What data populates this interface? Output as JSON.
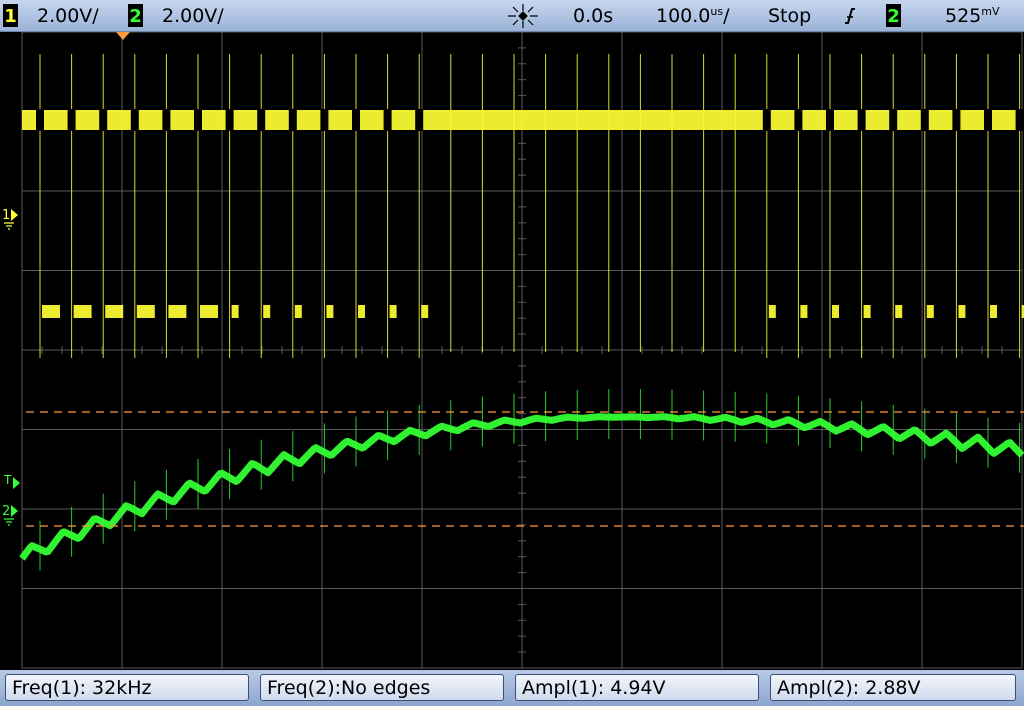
{
  "status_bar": {
    "ch1_label": "1",
    "ch1_scale": "2.00V/",
    "ch2_label": "2",
    "ch2_scale": "2.00V/",
    "acq_icon": "acquisition-icon",
    "time_offset": "0.0s",
    "timebase_value": "100.0",
    "timebase_unit": "us",
    "timebase_suffix": "/",
    "run_state": "Stop",
    "trigger_slope_icon": "rising-edge-icon",
    "trigger_source": "2",
    "trigger_level_value": "525",
    "trigger_level_unit": "mV"
  },
  "screen": {
    "ch1_marker": "1",
    "ch2_marker": "2",
    "trigger_marker": "T",
    "colors": {
      "background": "#000000",
      "grid": "#5a5a5a",
      "channel1": "#ffff33",
      "channel2": "#33ff33",
      "cursor": "#ff9a3a"
    }
  },
  "measurements": [
    {
      "label": "Freq(1): 32kHz"
    },
    {
      "label": "Freq(2):No edges"
    },
    {
      "label": "Ampl(1): 4.94V"
    },
    {
      "label": "Ampl(2): 2.88V"
    }
  ]
}
